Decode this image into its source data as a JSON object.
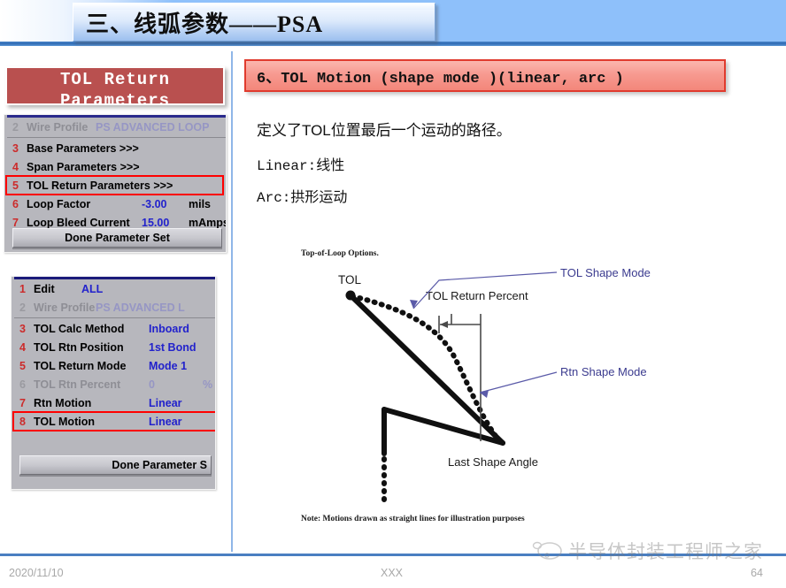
{
  "slide": {
    "title": "三、线弧参数——PSA",
    "page_number": "64",
    "footer_date": "2020/11/10",
    "footer_center": "XXX",
    "watermark": "半导体封装工程师之家"
  },
  "colors": {
    "banner_blue": "#8ec0fa",
    "banner_rule": "#2f6cb5",
    "red_title_bg": "#b9504f",
    "section_header_bg": "#f3867a",
    "section_header_border": "#e03b2e",
    "panel_bg": "#b7b7bd",
    "highlight_red": "#ff0000",
    "value_blue": "#2222cc",
    "index_red": "#cc2b2b",
    "footer_rule": "#4a7fc1",
    "divider_blue": "#8fb6e8"
  },
  "left": {
    "red_title": "TOL Return Parameters",
    "panel1": {
      "rows": [
        {
          "num": "2",
          "label": "Wire Profile",
          "value": "PS ADVANCED LOOP",
          "unit": "",
          "dim": true,
          "highlight": false
        },
        {
          "num": "3",
          "label": "Base Parameters >>>",
          "value": "",
          "unit": "",
          "dim": false,
          "highlight": false
        },
        {
          "num": "4",
          "label": "Span Parameters >>>",
          "value": "",
          "unit": "",
          "dim": false,
          "highlight": false
        },
        {
          "num": "5",
          "label": "TOL Return Parameters >>>",
          "value": "",
          "unit": "",
          "dim": false,
          "highlight": true
        },
        {
          "num": "6",
          "label": "Loop Factor",
          "value": "-3.00",
          "unit": "mils",
          "dim": false,
          "highlight": false
        },
        {
          "num": "7",
          "label": "Loop Bleed Current",
          "value": "15.00",
          "unit": "mAmps",
          "dim": false,
          "highlight": false
        }
      ],
      "done_label": "Done Parameter Set"
    },
    "panel2": {
      "rows": [
        {
          "num": "1",
          "label": "Edit",
          "value": "ALL",
          "unit": "",
          "dim": false,
          "highlight": false
        },
        {
          "num": "2",
          "label": "Wire Profile",
          "value": "PS ADVANCED L",
          "unit": "",
          "dim": true,
          "highlight": false
        },
        {
          "num": "3",
          "label": "TOL Calc Method",
          "value": "Inboard",
          "unit": "",
          "dim": false,
          "highlight": false
        },
        {
          "num": "4",
          "label": "TOL Rtn Position",
          "value": "1st Bond",
          "unit": "",
          "dim": false,
          "highlight": false
        },
        {
          "num": "5",
          "label": "TOL Return Mode",
          "value": "Mode 1",
          "unit": "",
          "dim": false,
          "highlight": false
        },
        {
          "num": "6",
          "label": "TOL Rtn Percent",
          "value": "0",
          "unit": "%",
          "dim": true,
          "highlight": false
        },
        {
          "num": "7",
          "label": "Rtn Motion",
          "value": "Linear",
          "unit": "",
          "dim": false,
          "highlight": false
        },
        {
          "num": "8",
          "label": "TOL Motion",
          "value": "Linear",
          "unit": "",
          "dim": false,
          "highlight": true
        }
      ],
      "done_label": "Done Parameter S"
    }
  },
  "right": {
    "section_header": "6、TOL Motion (shape mode )(linear, arc )",
    "body": [
      "定义了TOL位置最后一个运动的路径。",
      "Linear:线性",
      "Arc:拱形运动"
    ],
    "diagram": {
      "caption": "Top-of-Loop Options.",
      "labels": {
        "tol": "TOL",
        "tol_return_percent": "TOL Return Percent",
        "tol_shape_mode": "TOL Shape Mode",
        "rtn_shape_mode": "Rtn Shape Mode",
        "last_shape_angle": "Last Shape Angle"
      },
      "note": "Note: Motions drawn as straight lines for illustration purposes"
    }
  }
}
